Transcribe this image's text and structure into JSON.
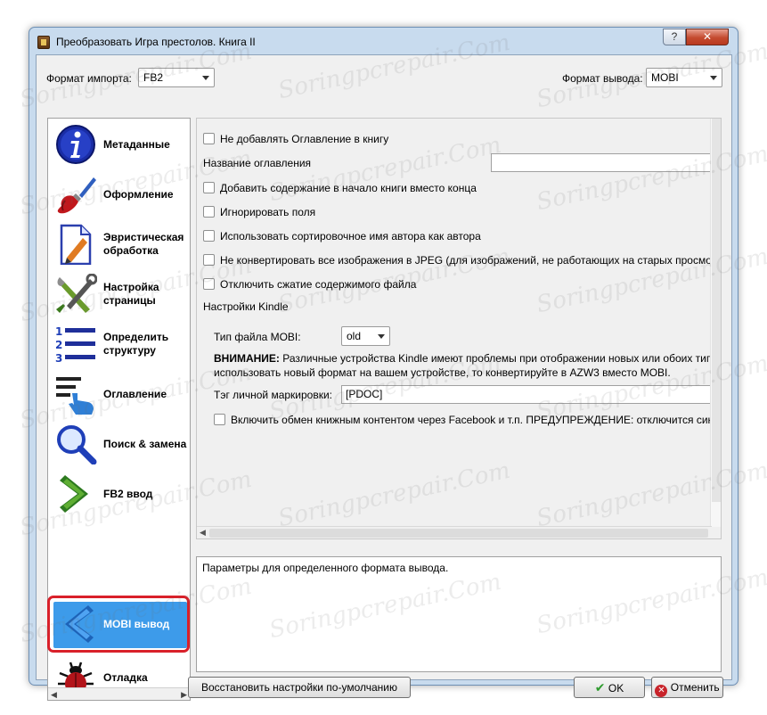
{
  "window": {
    "title": "Преобразовать Игра престолов. Книга II",
    "help_label": "?",
    "close_label": "✕"
  },
  "header": {
    "import_label": "Формат импорта:",
    "import_value": "FB2",
    "output_label": "Формат вывода:",
    "output_value": "MOBI"
  },
  "sidebar": {
    "items": [
      {
        "label": "Метаданные",
        "icon": "info-icon"
      },
      {
        "label": "Оформление",
        "icon": "brush-icon"
      },
      {
        "label": "Эвристическая обработка",
        "icon": "document-icon"
      },
      {
        "label": "Настройка страницы",
        "icon": "tools-icon"
      },
      {
        "label": "Определить структуру",
        "icon": "list-icon"
      },
      {
        "label": "Оглавление",
        "icon": "toc-hand-icon"
      },
      {
        "label": "Поиск & замена",
        "icon": "magnifier-icon"
      },
      {
        "label": "FB2 ввод",
        "icon": "arrow-right-icon"
      },
      {
        "label": "MOBI вывод",
        "icon": "arrow-left-icon",
        "selected": true
      },
      {
        "label": "Отладка",
        "icon": "bug-icon"
      }
    ]
  },
  "options": {
    "no_toc": "Не добавлять Оглавление в книгу",
    "toc_title_label": "Название оглавления",
    "toc_title_value": "",
    "toc_at_start": "Добавить содержание в начало книги вместо конца",
    "ignore_margins": "Игнорировать поля",
    "sort_author": "Использовать сортировочное имя автора как автора",
    "no_jpeg": "Не конвертировать все изображения в JPEG (для изображений, не работающих на старых просмотрщ",
    "no_compress": "Отключить сжатие содержимого файла"
  },
  "kindle": {
    "group_label": "Настройки Kindle",
    "file_type_label": "Тип файла MOBI:",
    "file_type_value": "old",
    "warning_bold": "ВНИМАНИЕ:",
    "warning_line1": " Различные устройства Kindle имеют проблемы при отображении новых или обоих типо",
    "warning_line2": "использовать новый формат на вашем устройстве, то конвертируйте в AZW3 вместо MOBI.",
    "tag_label": "Тэг личной маркировки:",
    "tag_value": "[PDOC]",
    "share_label": "Включить обмен книжным контентом через Facebook и т.п. ПРЕДУПРЕЖДЕНИЕ: отключится синхр"
  },
  "description": {
    "text": "Параметры для определенного формата вывода."
  },
  "footer": {
    "restore_label": "Восстановить настройки по-умолчанию",
    "ok_label": "OK",
    "cancel_label": "Отменить"
  },
  "watermark": {
    "text": "Soringpcrepair.Com"
  },
  "colors": {
    "selected_bg": "#3d9bea",
    "highlight_frame": "#d9202a",
    "ok_check": "#2e9b2e",
    "cancel_x": "#c8242b"
  }
}
